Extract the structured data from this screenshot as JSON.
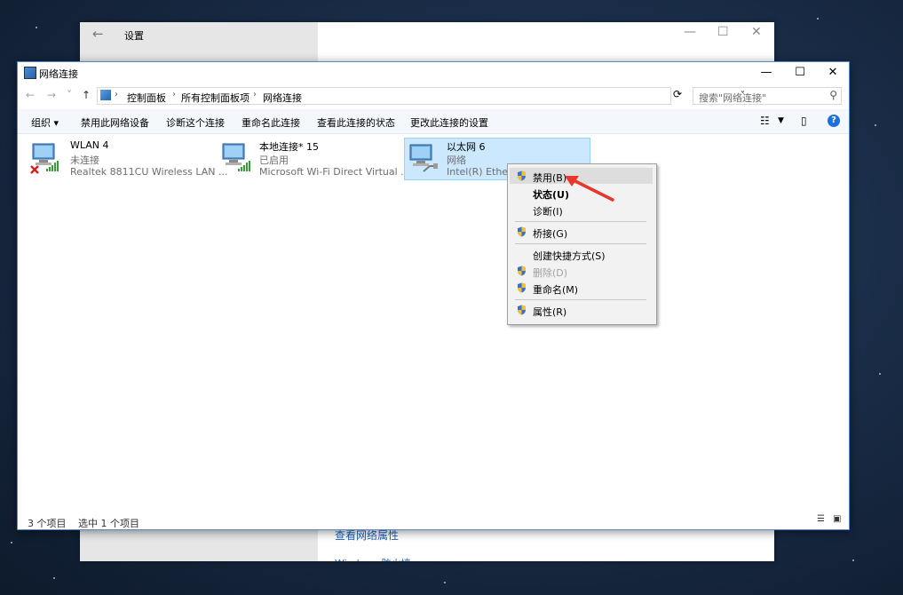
{
  "settings_window": {
    "title": "设置",
    "back": "←",
    "minimize": "—",
    "maximize": "☐",
    "close": "✕",
    "link_network_properties": "查看网络属性",
    "link_windows_firewall": "Windows 防火墙"
  },
  "window": {
    "title": "网络连接",
    "minimize": "—",
    "maximize": "☐",
    "close": "✕"
  },
  "address": {
    "back": "←",
    "forward": "→",
    "recent": "˅",
    "up": "↑",
    "crumbs": [
      "控制面板",
      "所有控制面板项",
      "网络连接"
    ],
    "sep": "›",
    "dropdown": "˅",
    "refresh": "⟳"
  },
  "search": {
    "placeholder": "搜索\"网络连接\"",
    "icon": "search-icon"
  },
  "toolbar": {
    "organize": "组织 ▾",
    "items": [
      "禁用此网络设备",
      "诊断这个连接",
      "重命名此连接",
      "查看此连接的状态",
      "更改此连接的设置"
    ]
  },
  "connections": [
    {
      "name": "WLAN 4",
      "status": "未连接",
      "device": "Realtek 8811CU Wireless LAN ...",
      "selected": false,
      "badge": "red-x"
    },
    {
      "name": "本地连接* 15",
      "status": "已启用",
      "device": "Microsoft Wi-Fi Direct Virtual ...",
      "selected": false,
      "badge": "signal"
    },
    {
      "name": "以太网 6",
      "status": "网络",
      "device": "Intel(R) Etherne",
      "selected": true,
      "badge": "cable"
    }
  ],
  "context_menu": {
    "items": [
      {
        "label": "禁用(B)",
        "shield": true,
        "bold": false,
        "disabled": false
      },
      {
        "label": "状态(U)",
        "shield": false,
        "bold": true,
        "disabled": false
      },
      {
        "label": "诊断(I)",
        "shield": false,
        "bold": false,
        "disabled": false
      },
      {
        "label": "桥接(G)",
        "shield": true,
        "bold": false,
        "disabled": false
      },
      {
        "label": "创建快捷方式(S)",
        "shield": false,
        "bold": false,
        "disabled": false
      },
      {
        "label": "删除(D)",
        "shield": true,
        "bold": false,
        "disabled": true
      },
      {
        "label": "重命名(M)",
        "shield": true,
        "bold": false,
        "disabled": false
      },
      {
        "label": "属性(R)",
        "shield": true,
        "bold": false,
        "disabled": false
      }
    ]
  },
  "statusbar": {
    "count": "3 个项目",
    "selected": "选中 1 个项目"
  },
  "colors": {
    "accent": "#1e6fd9",
    "selection": "#cce8ff",
    "annotation_arrow": "#e8372c"
  }
}
